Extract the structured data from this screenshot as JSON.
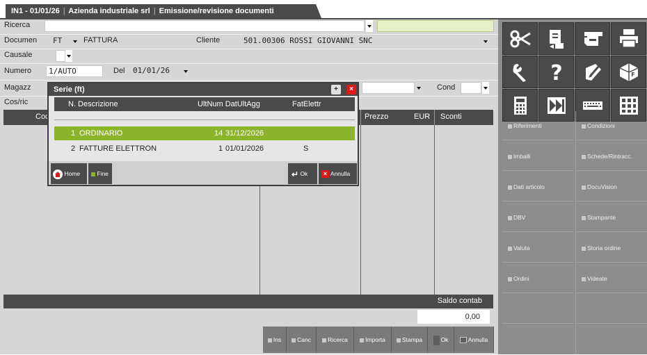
{
  "tab": {
    "company_code": "IN1 - 01/01/26",
    "company_name": "Azienda industriale srl",
    "screen": "Emissione/revisione documenti"
  },
  "form": {
    "ricerca_label": "Ricerca",
    "documento_label": "Documen",
    "documento_code": "FT",
    "documento_desc": "FATTURA",
    "cliente_label": "Cliente",
    "cliente_value": "501.00306 ROSSI GIOVANNI SNC",
    "causale_label": "Causale",
    "numero_label": "Numero",
    "numero_value": "1/AUTO",
    "del_label": "Del",
    "del_value": "01/01/26",
    "magazz_label": "Magazz",
    "cond_label": "Cond",
    "cosric_label": "Cos/ric"
  },
  "grid": {
    "col_cod": "Coc",
    "col_prezzo": "Prezzo",
    "col_eur": "EUR",
    "col_sconti": "Sconti"
  },
  "saldo": {
    "label": "Saldo contab",
    "value": "0,00"
  },
  "modal": {
    "title": "Serie (ft)",
    "headers": {
      "num_desc": "N. Descrizione",
      "ultnum_data": "UltNum DatUltAgg",
      "fatelettr": "FatElettr"
    },
    "rows": [
      {
        "num": "1",
        "desc": "ORDINARIO",
        "ultnum": "14",
        "data": "31/12/2026",
        "fatelettr": "",
        "selected": true
      },
      {
        "num": "2",
        "desc": "FATTURE ELETTRON",
        "ultnum": "1",
        "data": "01/01/2026",
        "fatelettr": "S",
        "selected": false
      }
    ],
    "buttons": {
      "home": "Home",
      "fine": "Fine",
      "ok": "Ok",
      "annulla": "Annulla"
    }
  },
  "bottom_buttons": [
    "Ins",
    "Canc",
    "Ricerca",
    "Importa",
    "Stampa",
    "Ok",
    "Annulla"
  ],
  "right_panel": {
    "icon_buttons": [
      "scissors-icon",
      "copy-icon",
      "car-icon",
      "printer-icon",
      "wrench-icon",
      "help-icon",
      "edit-icon",
      "box-icon",
      "calculator-icon",
      "fast-forward-icon",
      "keyboard-icon",
      "grid-icon"
    ],
    "function_buttons": [
      [
        "Riferimenti",
        "Condizioni"
      ],
      [
        "Imballi",
        "Schede/Rintracc."
      ],
      [
        "Dati articolo",
        "DocuVision"
      ],
      [
        "DBV",
        "Stampante"
      ],
      [
        "Valuta",
        "Storia ordine"
      ],
      [
        "Ordini",
        "Videate"
      ]
    ]
  },
  "colors": {
    "selected_row": "#8bb32c",
    "header_dark": "#4a4a4a",
    "form_bg": "#d6d6d6",
    "panel_bg": "#8d8d8d",
    "ricerca_highlight": "#e6f1c8",
    "close_red": "#d81c1c"
  }
}
